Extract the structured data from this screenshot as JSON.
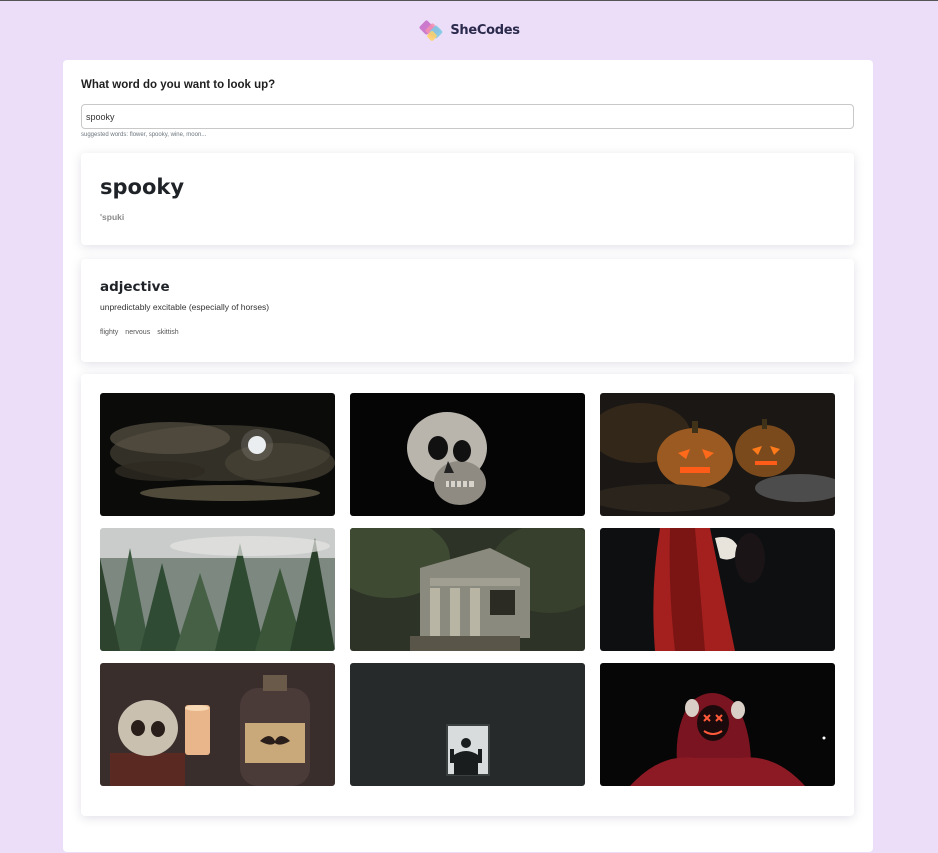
{
  "header": {
    "logo_text": "SheCodes"
  },
  "search": {
    "question": "What word do you want to look up?",
    "value": "spooky",
    "hint": "suggested words: flower, spooky, wine, moon..."
  },
  "word": {
    "text": "spooky",
    "phonetic": "'spuki"
  },
  "meanings": [
    {
      "part_of_speech": "adjective",
      "definition": "unpredictably excitable (especially of horses)",
      "synonyms": [
        "flighty",
        "nervous",
        "skittish"
      ]
    }
  ],
  "photos": [
    {
      "icon": "moon-clouds-photo",
      "alt": "full moon behind clouds at night"
    },
    {
      "icon": "skull-photo",
      "alt": "human skull on black background"
    },
    {
      "icon": "pumpkins-photo",
      "alt": "carved jack-o-lantern pumpkins"
    },
    {
      "icon": "foggy-forest-photo",
      "alt": "misty pine forest"
    },
    {
      "icon": "abandoned-house-photo",
      "alt": "abandoned house in forest"
    },
    {
      "icon": "red-cloak-photo",
      "alt": "figure in red cloak"
    },
    {
      "icon": "skull-candle-photo",
      "alt": "skull, candle and bottle still life"
    },
    {
      "icon": "window-silhouette-photo",
      "alt": "silhouette in bright window"
    },
    {
      "icon": "neon-mask-photo",
      "alt": "person in red hoodie with neon mask"
    }
  ],
  "colors": {
    "page_background": "#ecdef9",
    "container_background": "#ffffff",
    "text": "#212529",
    "phonetic": "#8a8a8a"
  }
}
